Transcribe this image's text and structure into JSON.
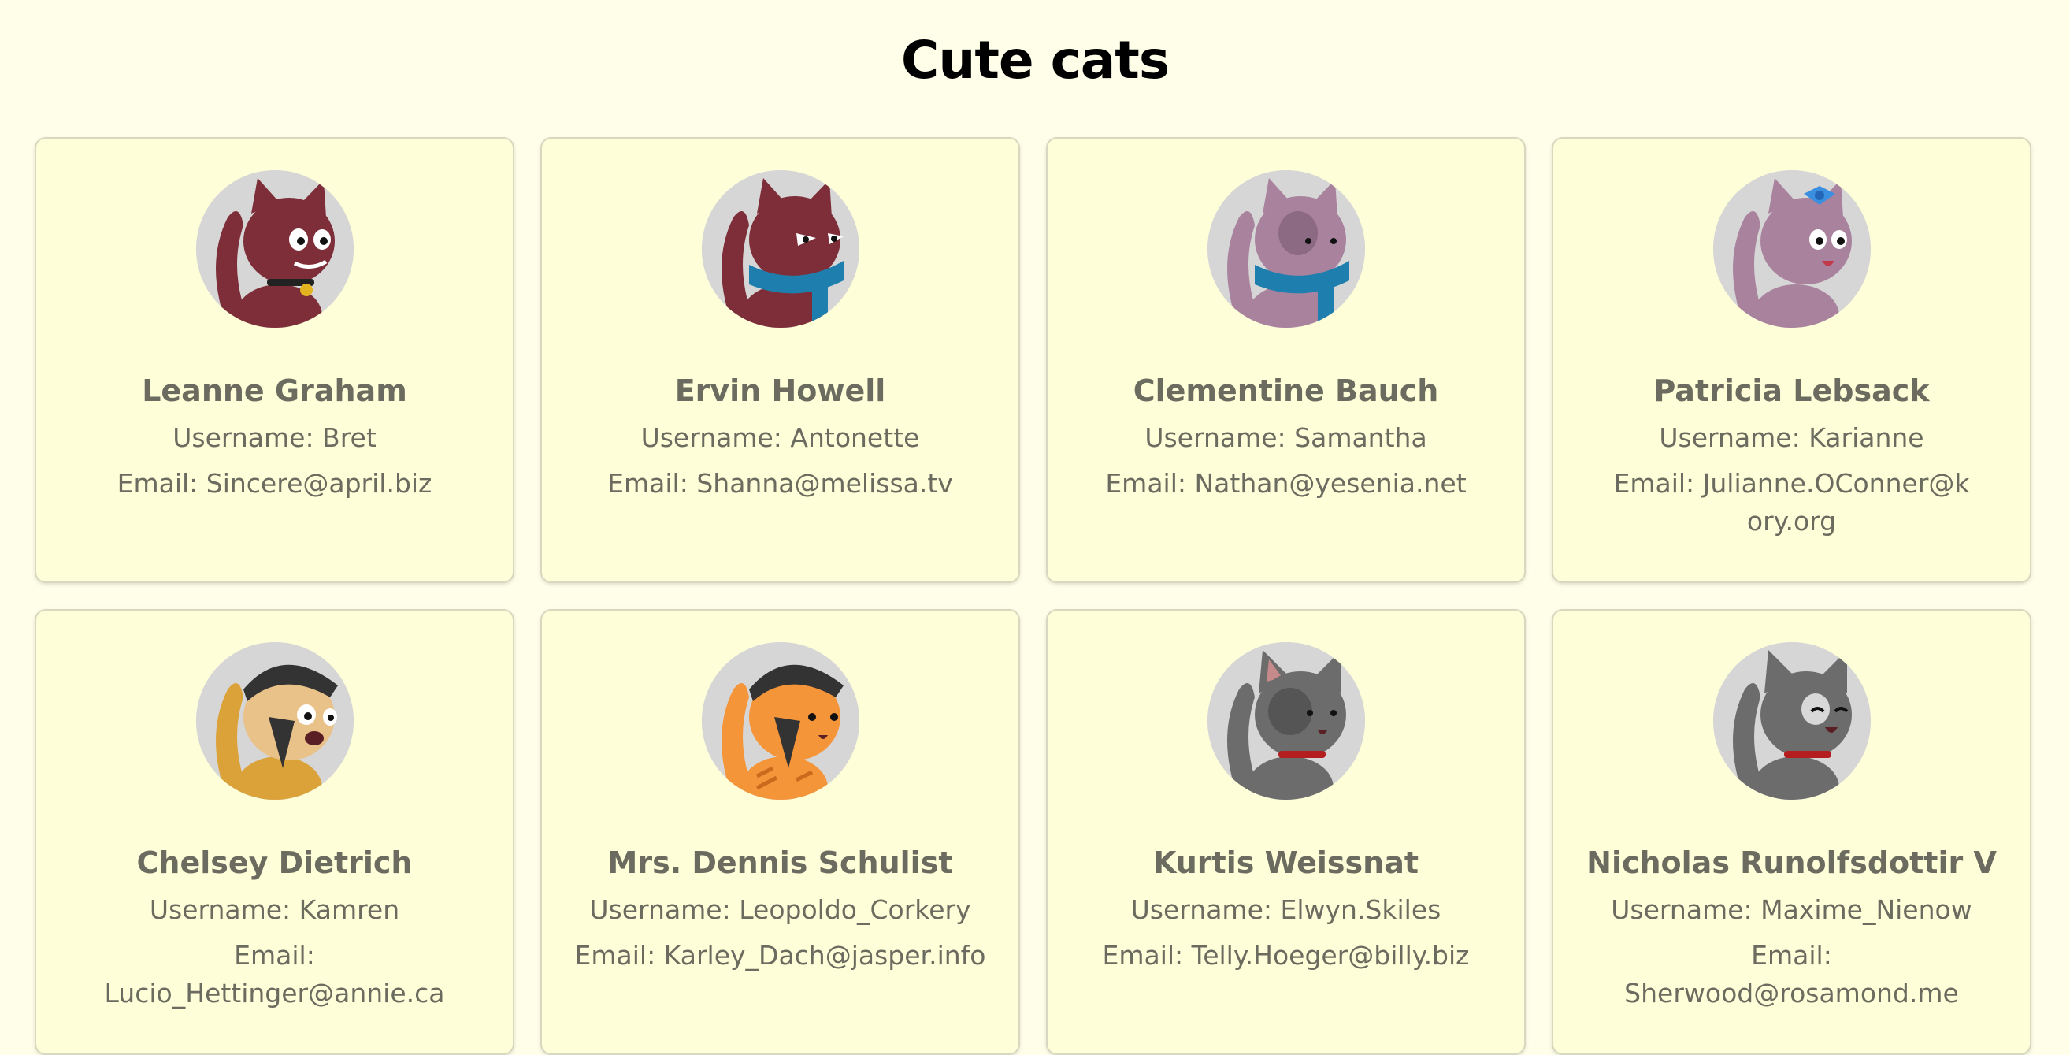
{
  "page": {
    "title": "Cute cats",
    "background": "#fefee9",
    "card_background": "#fefed8",
    "text_color": "#6b6b60"
  },
  "cats": [
    {
      "name": "Leanne Graham",
      "username": "Username: Bret",
      "email": "Email: Sincere@april.biz",
      "avatar_icon": "maroon-cat-bell-collar",
      "fur_color": "#7d2e38"
    },
    {
      "name": "Ervin Howell",
      "username": "Username: Antonette",
      "email": "Email: Shanna@melissa.tv",
      "avatar_icon": "maroon-cat-blue-scarf",
      "fur_color": "#7d2e38"
    },
    {
      "name": "Clementine Bauch",
      "username": "Username: Samantha",
      "email": "Email: Nathan@yesenia.net",
      "avatar_icon": "pink-cat-blue-scarf",
      "fur_color": "#a9829e"
    },
    {
      "name": "Patricia Lebsack",
      "username": "Username: Karianne",
      "email": "Email: Julianne.OConner@kory.org",
      "avatar_icon": "pink-cat-blue-bow",
      "fur_color": "#a9829e"
    },
    {
      "name": "Chelsey Dietrich",
      "username": "Username: Kamren",
      "email": "Email: Lucio_Hettinger@annie.ca",
      "avatar_icon": "calico-cat-bandana",
      "fur_color": "#dca23a"
    },
    {
      "name": "Mrs. Dennis Schulist",
      "username": "Username: Leopoldo_Corkery",
      "email": "Email: Karley_Dach@jasper.info",
      "avatar_icon": "orange-tabby-cat-bandana",
      "fur_color": "#f5953a"
    },
    {
      "name": "Kurtis Weissnat",
      "username": "Username: Elwyn.Skiles",
      "email": "Email: Telly.Hoeger@billy.biz",
      "avatar_icon": "gray-cat-red-collar",
      "fur_color": "#6c6c6c"
    },
    {
      "name": "Nicholas Runolfsdottir V",
      "username": "Username: Maxime_Nienow",
      "email": "Email: Sherwood@rosamond.me",
      "avatar_icon": "gray-cat-happy-red-collar",
      "fur_color": "#6c6c6c"
    }
  ]
}
